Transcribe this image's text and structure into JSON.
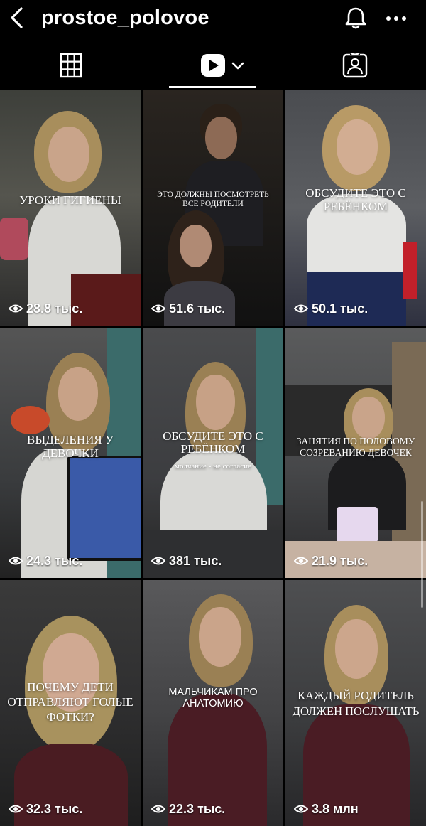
{
  "header": {
    "username": "prostoe_polovoe",
    "back_icon": "chevron-left-icon",
    "bell_icon": "bell-icon",
    "more_icon": "more-horizontal-icon"
  },
  "tabs": [
    {
      "name": "grid",
      "icon": "grid-icon",
      "active": false
    },
    {
      "name": "reels",
      "icon": "reels-icon",
      "active": true
    },
    {
      "name": "tagged",
      "icon": "tagged-person-icon",
      "active": false
    }
  ],
  "reels": [
    {
      "title": "УРОКИ ГИГИЕНЫ",
      "views": "28.8 тыс."
    },
    {
      "title": "ЭТО ДОЛЖНЫ ПОСМОТРЕТЬ ВСЕ РОДИТЕЛИ",
      "views": "51.6 тыс."
    },
    {
      "title": "ОБСУДИТЕ ЭТО С РЕБЁНКОМ",
      "views": "50.1 тыс."
    },
    {
      "title": "ВЫДЕЛЕНИЯ У ДЕВОЧКИ",
      "views": "24.3 тыс."
    },
    {
      "title": "ОБСУДИТЕ ЭТО С РЕБЁНКОМ",
      "subtitle": "молчание - не согласие",
      "views": "381 тыс."
    },
    {
      "title": "ЗАНЯТИЯ ПО ПОЛОВОМУ СОЗРЕВАНИЮ ДЕВОЧЕК",
      "views": "21.9 тыс."
    },
    {
      "title": "ПОЧЕМУ ДЕТИ ОТПРАВЛЯЮТ ГОЛЫЕ ФОТКИ?",
      "views": "32.3 тыс."
    },
    {
      "title": "МАЛЬЧИКАМ ПРО АНАТОМИЮ",
      "views": "22.3 тыс."
    },
    {
      "title": "КАЖДЫЙ РОДИТЕЛЬ ДОЛЖЕН ПОСЛУШАТЬ",
      "views": "3.8 млн"
    }
  ],
  "colors": {
    "background": "#000000",
    "text": "#ffffff"
  }
}
